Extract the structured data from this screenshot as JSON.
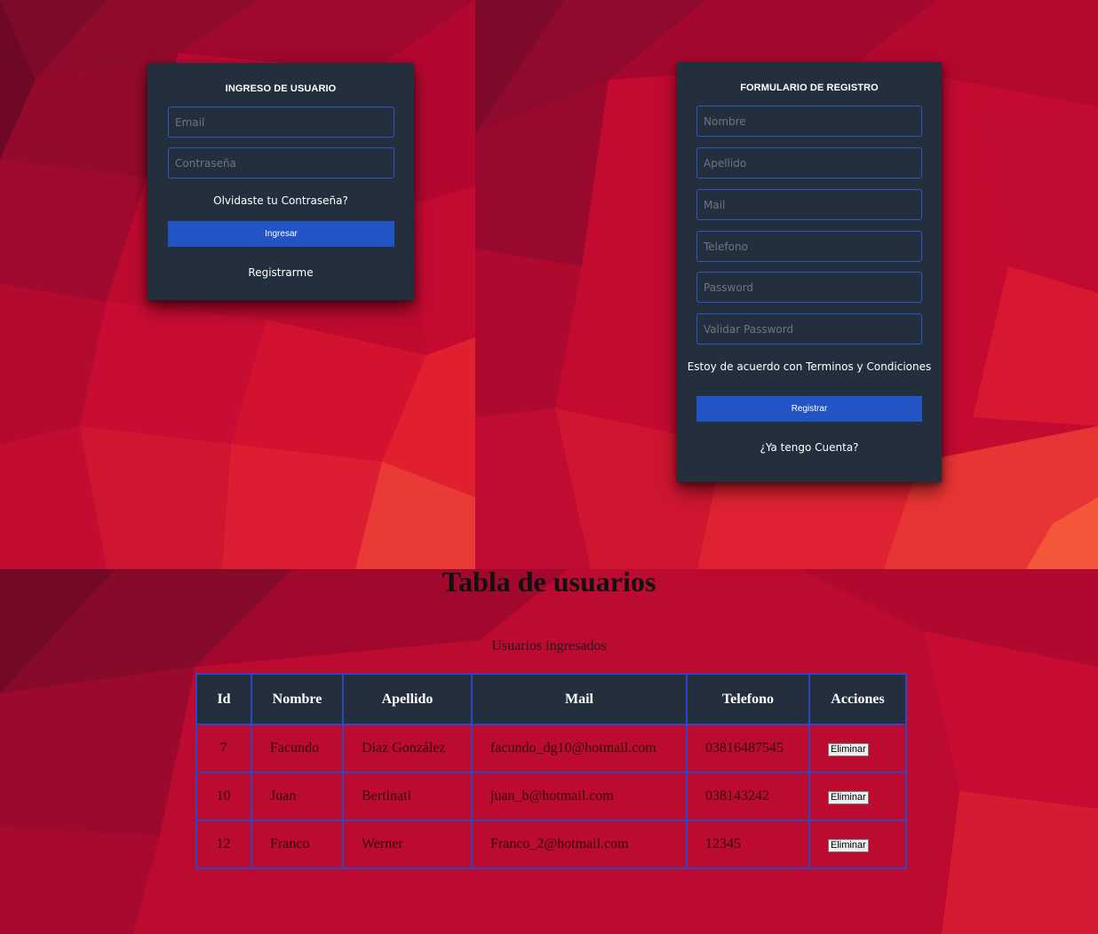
{
  "colors": {
    "card_bg": "#232f3d",
    "accent_blue": "#2254c6",
    "field_border": "#2f55c4",
    "background_red": "#c8002f"
  },
  "login": {
    "title": "INGRESO DE USUARIO",
    "email_placeholder": "Email",
    "password_placeholder": "Contraseña",
    "forgot_link": "Olvidaste tu Contraseña?",
    "submit_label": "Ingresar",
    "register_link": "Registrarme"
  },
  "register": {
    "title": "FORMULARIO DE REGISTRO",
    "fields": {
      "nombre": "Nombre",
      "apellido": "Apellido",
      "mail": "Mail",
      "telefono": "Telefono",
      "password": "Password",
      "validar_password": "Validar Password"
    },
    "terms_text": "Estoy de acuerdo con Terminos y Condiciones",
    "submit_label": "Registrar",
    "login_link": "¿Ya tengo Cuenta?"
  },
  "users_table": {
    "title": "Tabla de usuarios",
    "subtitle": "Usuarios ingresados",
    "headers": [
      "Id",
      "Nombre",
      "Apellido",
      "Mail",
      "Telefono",
      "Acciones"
    ],
    "rows": [
      [
        "7",
        "Facundo",
        "Diaz González",
        "facundo_dg10@hotmail.com",
        "03816487545"
      ],
      [
        "10",
        "Juan",
        "Bertinati",
        "juan_b@hotmail.com",
        "038143242"
      ],
      [
        "12",
        "Franco",
        "Werner",
        "Franco_2@hotmail.com",
        "12345"
      ]
    ],
    "action_label": "Eliminar"
  }
}
